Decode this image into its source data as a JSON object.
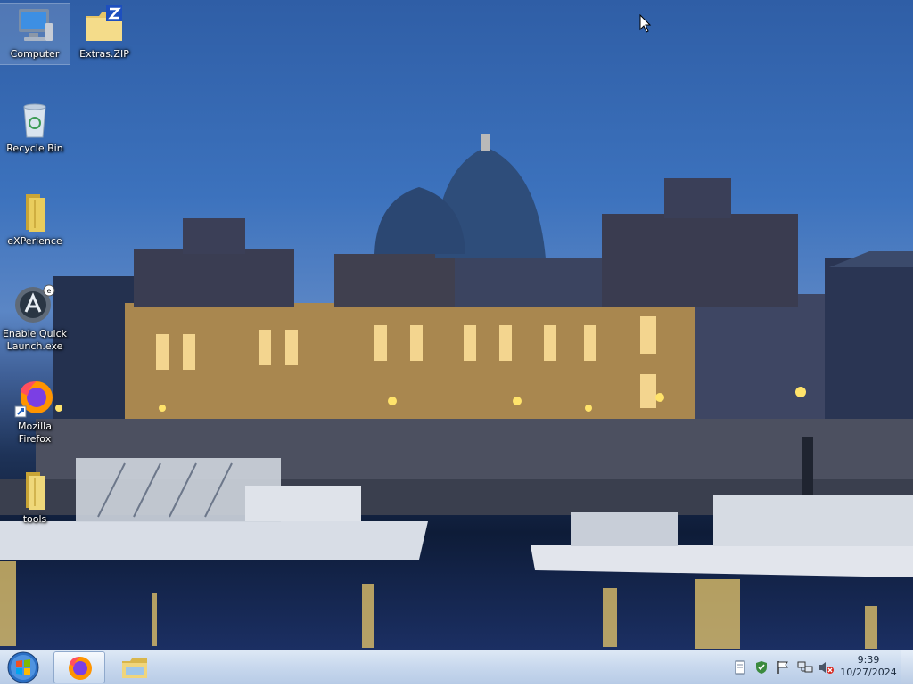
{
  "desktop": {
    "icons": {
      "computer": {
        "label": "Computer",
        "icon": "computer-icon"
      },
      "extras_zip": {
        "label": "Extras.ZIP",
        "icon": "zip-folder-icon"
      },
      "recycle_bin": {
        "label": "Recycle Bin",
        "icon": "recycle-bin-icon"
      },
      "experience": {
        "label": "eXPerience",
        "icon": "folder-icon"
      },
      "enable_quick_launch": {
        "label": "Enable Quick\nLaunch.exe",
        "icon": "quick-launch-app-icon"
      },
      "firefox": {
        "label": "Mozilla\nFirefox",
        "icon": "firefox-icon"
      },
      "tools": {
        "label": "tools",
        "icon": "folder-icon"
      }
    }
  },
  "taskbar": {
    "start": {
      "icon": "windows-start-orb-icon"
    },
    "pinned": [
      {
        "name": "Mozilla Firefox",
        "icon": "firefox-icon",
        "active": true
      },
      {
        "name": "Windows Explorer",
        "icon": "explorer-folder-icon",
        "active": false
      }
    ],
    "tray": {
      "icons": [
        "document-icon",
        "security-shield-icon",
        "action-center-flag-icon",
        "network-icon",
        "volume-muted-icon"
      ],
      "time": "9:39",
      "date": "10/27/2024"
    }
  },
  "colors": {
    "taskbar_top": "#dde8f5",
    "taskbar_bottom": "#b7cbe6",
    "sky": "#3c72bd",
    "water": "#1b2f63"
  }
}
